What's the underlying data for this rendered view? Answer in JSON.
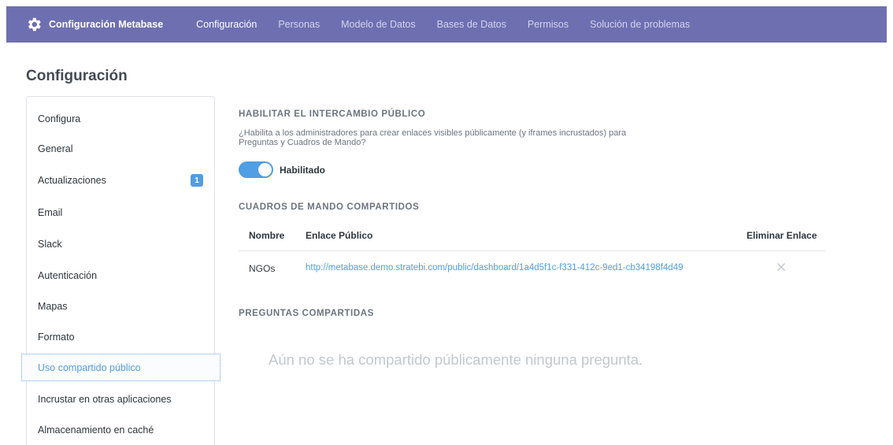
{
  "nav": {
    "brand_icon": "gear-icon",
    "brand_label": "Configuración Metabase",
    "links": [
      {
        "label": "Configuración",
        "active": true
      },
      {
        "label": "Personas",
        "active": false
      },
      {
        "label": "Modelo de Datos",
        "active": false
      },
      {
        "label": "Bases de Datos",
        "active": false
      },
      {
        "label": "Permisos",
        "active": false
      },
      {
        "label": "Solución de problemas",
        "active": false
      }
    ]
  },
  "page": {
    "title": "Configuración"
  },
  "sidebar": {
    "items": [
      {
        "label": "Configura"
      },
      {
        "label": "General"
      },
      {
        "label": "Actualizaciones",
        "badge": "1"
      },
      {
        "label": "Email"
      },
      {
        "label": "Slack"
      },
      {
        "label": "Autenticación"
      },
      {
        "label": "Mapas"
      },
      {
        "label": "Formato"
      },
      {
        "label": "Uso compartido público",
        "selected": true
      },
      {
        "label": "Incrustar en otras aplicaciones"
      },
      {
        "label": "Almacenamiento en caché"
      }
    ]
  },
  "public_sharing": {
    "title": "HABILITAR EL INTERCAMBIO PÚBLICO",
    "description_line1": "¿Habilita a los administradores para crear enlaces visibles públicamente (y iframes incrustados) para",
    "description_line2": "Preguntas y Cuadros de Mando?",
    "toggle_on": true,
    "toggle_label": "Habilitado"
  },
  "shared_dashboards": {
    "title": "CUADROS DE MANDO COMPARTIDOS",
    "columns": [
      "Nombre",
      "Enlace Público",
      "Eliminar Enlace"
    ],
    "rows": [
      {
        "name": "NGOs",
        "link": "http://metabase.demo.stratebi.com/public/dashboard/1a4d5f1c-f331-412c-9ed1-cb34198f4d49",
        "remove_icon": "close-icon"
      }
    ]
  },
  "shared_questions": {
    "title": "PREGUNTAS COMPARTIDAS",
    "empty_message": "Aún no se ha compartido públicamente ninguna pregunta."
  },
  "colors": {
    "nav_bg": "#6e6fb1",
    "accent": "#509ee3",
    "muted_text": "#6c7480"
  }
}
